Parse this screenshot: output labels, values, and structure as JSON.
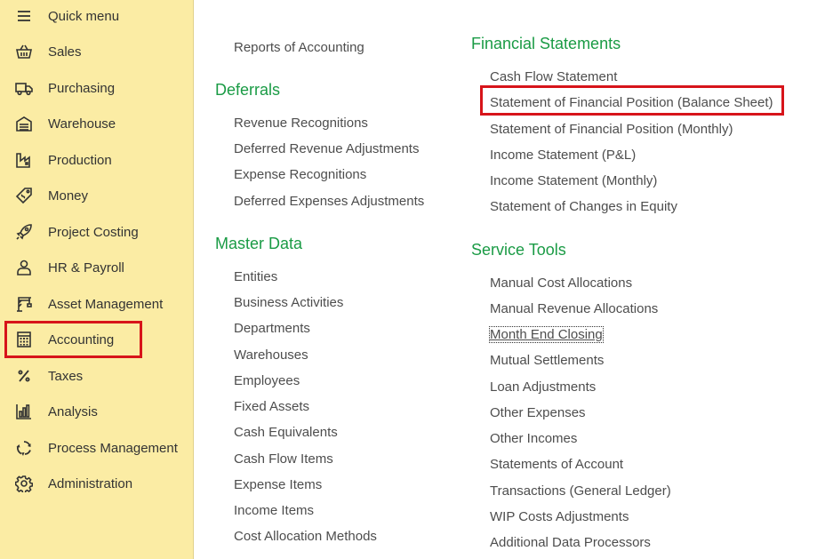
{
  "sidebar": {
    "items": [
      {
        "label": "Quick menu",
        "icon": "hamburger-icon"
      },
      {
        "label": "Sales",
        "icon": "basket-icon"
      },
      {
        "label": "Purchasing",
        "icon": "truck-icon"
      },
      {
        "label": "Warehouse",
        "icon": "warehouse-icon"
      },
      {
        "label": "Production",
        "icon": "factory-icon"
      },
      {
        "label": "Money",
        "icon": "money-tag-icon"
      },
      {
        "label": "Project Costing",
        "icon": "rocket-icon"
      },
      {
        "label": "HR & Payroll",
        "icon": "person-icon"
      },
      {
        "label": "Asset Management",
        "icon": "crane-icon"
      },
      {
        "label": "Accounting",
        "icon": "calculator-icon",
        "active": true
      },
      {
        "label": "Taxes",
        "icon": "percent-icon"
      },
      {
        "label": "Analysis",
        "icon": "bar-chart-icon"
      },
      {
        "label": "Process Management",
        "icon": "cycle-icon"
      },
      {
        "label": "Administration",
        "icon": "gear-icon"
      }
    ]
  },
  "left_column": {
    "top_link": "Reports of Accounting",
    "deferrals": {
      "title": "Deferrals",
      "links": [
        "Revenue Recognitions",
        "Deferred Revenue Adjustments",
        "Expense Recognitions",
        "Deferred Expenses Adjustments"
      ]
    },
    "master_data": {
      "title": "Master Data",
      "links": [
        "Entities",
        "Business Activities",
        "Departments",
        "Warehouses",
        "Employees",
        "Fixed Assets",
        "Cash Equivalents",
        "Cash Flow Items",
        "Expense Items",
        "Income Items",
        "Cost Allocation Methods"
      ]
    }
  },
  "right_column": {
    "financial_statements": {
      "title": "Financial Statements",
      "links": [
        "Cash Flow Statement",
        "Statement of Financial Position (Balance Sheet)",
        "Statement of Financial Position (Monthly)",
        "Income Statement (P&L)",
        "Income Statement (Monthly)",
        "Statement of Changes in Equity"
      ]
    },
    "service_tools": {
      "title": "Service Tools",
      "links": [
        "Manual Cost Allocations",
        "Manual Revenue Allocations",
        "Month End Closing",
        "Mutual Settlements",
        "Loan Adjustments",
        "Other Expenses",
        "Other Incomes",
        "Statements of Account",
        "Transactions (General Ledger)",
        "WIP Costs Adjustments",
        "Additional Data Processors"
      ]
    }
  },
  "colors": {
    "sidebar_bg": "#fbeca4",
    "section_title": "#1a9b45",
    "highlight": "#d7141a"
  }
}
